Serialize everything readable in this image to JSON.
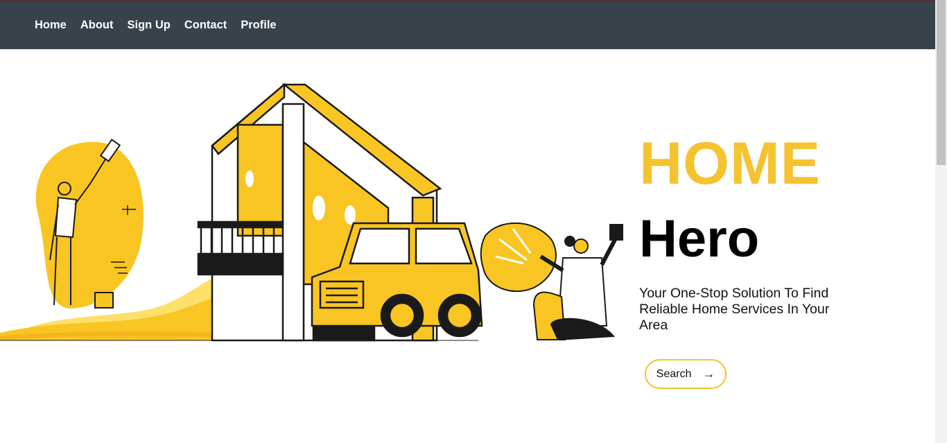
{
  "nav": {
    "items": [
      {
        "label": "Home"
      },
      {
        "label": "About"
      },
      {
        "label": "Sign Up"
      },
      {
        "label": "Contact"
      },
      {
        "label": "Profile"
      }
    ]
  },
  "hero": {
    "title_line1": "HOME",
    "title_line2": "Hero",
    "subtitle": "Your One-Stop Solution To Find Reliable Home Services In Your Area",
    "search_label": "Search",
    "search_arrow": "→"
  },
  "colors": {
    "navbar": "#37424a",
    "accent_yellow": "#f4c32f",
    "text_dark": "#000000"
  }
}
